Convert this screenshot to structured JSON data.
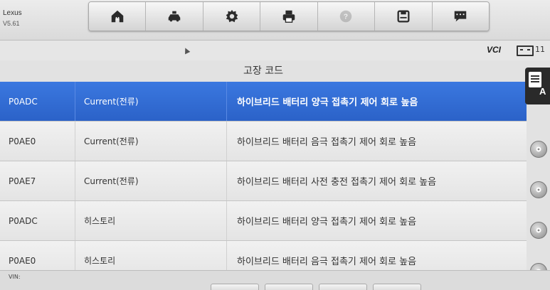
{
  "app": {
    "name": "Lexus",
    "version": "V5.61"
  },
  "toolbar": {
    "buttons": [
      {
        "name": "home",
        "icon": "home-icon"
      },
      {
        "name": "vehicle",
        "icon": "car-wrench-icon"
      },
      {
        "name": "settings",
        "icon": "gear-icon"
      },
      {
        "name": "print",
        "icon": "printer-icon"
      },
      {
        "name": "help",
        "icon": "help-icon",
        "disabled": true
      },
      {
        "name": "save",
        "icon": "save-icon"
      },
      {
        "name": "message",
        "icon": "message-icon"
      }
    ]
  },
  "status": {
    "vci": "VCI",
    "time": "11"
  },
  "page": {
    "title": "고장 코드"
  },
  "dtc_table": {
    "rows": [
      {
        "code": "P0ADC",
        "status": "Current(전류)",
        "description": "하이브리드 배터리 양극 접촉기 제어 회로 높음",
        "selected": true
      },
      {
        "code": "P0AE0",
        "status": "Current(전류)",
        "description": "하이브리드 배터리 음극 접촉기 제어 회로 높음",
        "selected": false
      },
      {
        "code": "P0AE7",
        "status": "Current(전류)",
        "description": "하이브리드 배터리 사전 충전 접촉기 제어 회로 높음",
        "selected": false
      },
      {
        "code": "P0ADC",
        "status": "히스토리",
        "description": "하이브리드 배터리 양극 접촉기 제어 회로 높음",
        "selected": false
      },
      {
        "code": "P0AE0",
        "status": "히스토리",
        "description": "하이브리드 배터리 음극 접촉기 제어 회로 높음",
        "selected": false
      }
    ]
  },
  "side_panel": {
    "letter": "A"
  },
  "footer": {
    "vin_label": "VIN:"
  },
  "colors": {
    "selected_row": "#2f6ad4",
    "row_bg": "#ececec",
    "header_bg": "#e4e4e4"
  }
}
